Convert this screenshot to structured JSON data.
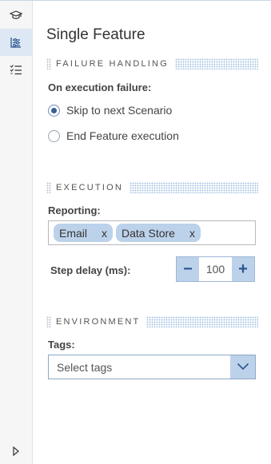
{
  "sidebar": {
    "items": [
      {
        "icon": "graduation-cap-icon",
        "active": false
      },
      {
        "icon": "flow-settings-icon",
        "active": true
      },
      {
        "icon": "checklist-icon",
        "active": false
      }
    ],
    "expand_icon": "triangle-right-icon"
  },
  "panel": {
    "title": "Single Feature",
    "failure": {
      "header": "FAILURE HANDLING",
      "label": "On execution failure:",
      "options": [
        {
          "label": "Skip to next Scenario",
          "checked": true
        },
        {
          "label": "End Feature execution",
          "checked": false
        }
      ]
    },
    "execution": {
      "header": "EXECUTION",
      "reporting_label": "Reporting:",
      "reporting_tags": [
        {
          "label": "Email",
          "remove": "x"
        },
        {
          "label": "Data Store",
          "remove": "x"
        }
      ],
      "step_delay_label": "Step delay (ms):",
      "step_delay_value": "100",
      "decrement": "−",
      "increment": "+"
    },
    "environment": {
      "header": "ENVIRONMENT",
      "tags_label": "Tags:",
      "tags_placeholder": "Select tags"
    }
  },
  "colors": {
    "accent": "#bcd2ea",
    "accent_dark": "#2d5590",
    "rail_active": "#dde8f4"
  }
}
